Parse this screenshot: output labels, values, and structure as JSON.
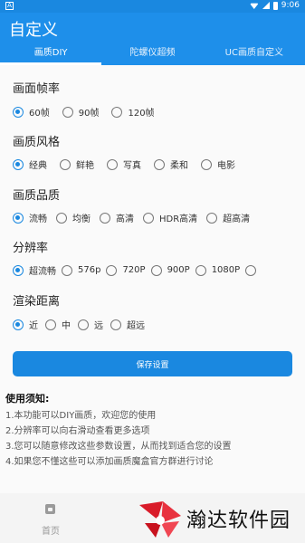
{
  "status_bar": {
    "time": "9:06",
    "notification_icon": "A"
  },
  "app": {
    "title": "自定义"
  },
  "tabs": [
    {
      "label": "画质DIY",
      "active": true
    },
    {
      "label": "陀螺仪超频",
      "active": false
    },
    {
      "label": "UC画质自定义",
      "active": false
    }
  ],
  "sections": {
    "frame_rate": {
      "title": "画面帧率",
      "options": [
        "60帧",
        "90帧",
        "120帧"
      ],
      "selected": "60帧"
    },
    "style": {
      "title": "画质风格",
      "options": [
        "经典",
        "鲜艳",
        "写真",
        "柔和",
        "电影"
      ],
      "selected": "经典"
    },
    "quality": {
      "title": "画质品质",
      "options": [
        "流畅",
        "均衡",
        "高清",
        "HDR高清",
        "超高清"
      ],
      "selected": "流畅"
    },
    "resolution": {
      "title": "分辨率",
      "options": [
        "超流畅",
        "576p",
        "720P",
        "900P",
        "1080P",
        ""
      ],
      "selected": "超流畅"
    },
    "distance": {
      "title": "渲染距离",
      "options": [
        "近",
        "中",
        "远",
        "超远"
      ],
      "selected": "近"
    }
  },
  "save_button": {
    "label": "保存设置"
  },
  "notes": {
    "title": "使用须知:",
    "lines": [
      "1.本功能可以DIY画质，欢迎您的使用",
      "2.分辨率可以向右滑动查看更多选项",
      "3.您可以随意修改这些参数设置，从而找到适合您的设置",
      "4.如果您不懂这些可以添加画质魔盒官方群进行讨论"
    ]
  },
  "bottom_nav": {
    "home_label": "首页",
    "home_icon": "home-icon"
  },
  "watermark": {
    "text": "瀚达软件园"
  },
  "colors": {
    "primary": "#1e8fea",
    "status_bar": "#1a88e0",
    "radio_checked": "#1a88e0"
  }
}
